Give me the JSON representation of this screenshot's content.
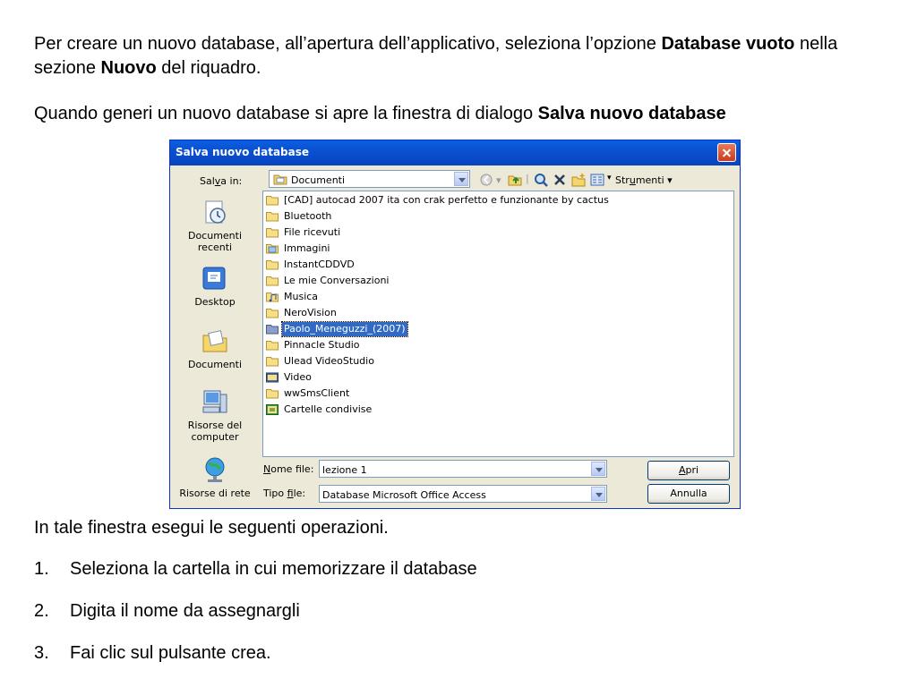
{
  "intro": {
    "p1_a": "Per creare un nuovo database, all’apertura dell’applicativo, seleziona l’opzione ",
    "p1_b": "Database vuoto",
    "p1_c": " nella sezione ",
    "p1_d": "Nuovo",
    "p1_e": " del riquadro.",
    "p2_a": "Quando generi un nuovo database si apre la finestra di dialogo ",
    "p2_b": "Salva nuovo database"
  },
  "dialog": {
    "title": "Salva nuovo database",
    "save_in_label_a": "Sal",
    "save_in_label_u": "v",
    "save_in_label_b": "a in:",
    "save_in_value": "Documenti",
    "tools_label_a": "Str",
    "tools_label_u": "u",
    "tools_label_b": "menti",
    "places": [
      "Documenti recenti",
      "Desktop",
      "Documenti",
      "Risorse del computer",
      "Risorse di rete"
    ],
    "files": [
      {
        "name": "[CAD] autocad 2007 ita con crak perfetto e funzionante by cactus",
        "icon": "folder-icon"
      },
      {
        "name": "Bluetooth",
        "icon": "folder-icon"
      },
      {
        "name": "File ricevuti",
        "icon": "folder-icon"
      },
      {
        "name": "Immagini",
        "icon": "pictures-folder-icon"
      },
      {
        "name": "InstantCDDVD",
        "icon": "folder-icon"
      },
      {
        "name": "Le mie Conversazioni",
        "icon": "folder-icon"
      },
      {
        "name": "Musica",
        "icon": "music-folder-icon"
      },
      {
        "name": "NeroVision",
        "icon": "folder-icon"
      },
      {
        "name": "Paolo_Meneguzzi_(2007)",
        "icon": "folder-icon",
        "selected": true
      },
      {
        "name": "Pinnacle Studio",
        "icon": "folder-icon"
      },
      {
        "name": "Ulead VideoStudio",
        "icon": "folder-icon"
      },
      {
        "name": "Video",
        "icon": "video-folder-icon"
      },
      {
        "name": "wwSmsClient",
        "icon": "folder-icon"
      },
      {
        "name": "Cartelle condivise",
        "icon": "shared-folder-icon"
      }
    ],
    "filename_label_u": "N",
    "filename_label_b": "ome file:",
    "filename_value": "lezione 1",
    "filetype_label_a": "Tipo ",
    "filetype_label_u": "f",
    "filetype_label_b": "ile:",
    "filetype_value": "Database Microsoft Office Access",
    "open_button_u": "A",
    "open_button_b": "pri",
    "cancel_button": "Annulla"
  },
  "outro": {
    "p3": "In tale finestra esegui le seguenti operazioni.",
    "steps": [
      {
        "num": "1.",
        "text": "Seleziona la cartella in cui memorizzare il database"
      },
      {
        "num": "2.",
        "text": "Digita il nome da assegnargli"
      },
      {
        "num": "3.",
        "text": "Fai clic sul pulsante crea."
      }
    ]
  }
}
